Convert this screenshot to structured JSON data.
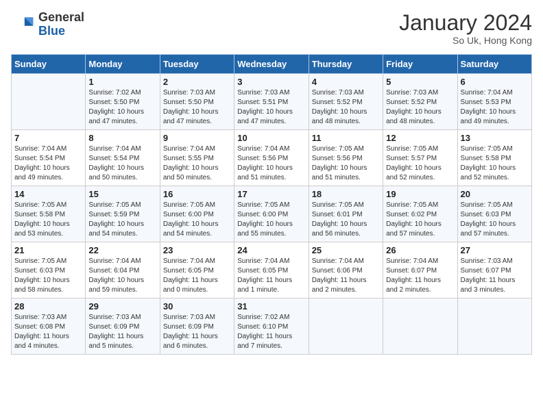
{
  "header": {
    "logo_line1": "General",
    "logo_line2": "Blue",
    "month": "January 2024",
    "location": "So Uk, Hong Kong"
  },
  "days_of_week": [
    "Sunday",
    "Monday",
    "Tuesday",
    "Wednesday",
    "Thursday",
    "Friday",
    "Saturday"
  ],
  "weeks": [
    [
      {
        "day": "",
        "info": ""
      },
      {
        "day": "1",
        "info": "Sunrise: 7:02 AM\nSunset: 5:50 PM\nDaylight: 10 hours\nand 47 minutes."
      },
      {
        "day": "2",
        "info": "Sunrise: 7:03 AM\nSunset: 5:50 PM\nDaylight: 10 hours\nand 47 minutes."
      },
      {
        "day": "3",
        "info": "Sunrise: 7:03 AM\nSunset: 5:51 PM\nDaylight: 10 hours\nand 47 minutes."
      },
      {
        "day": "4",
        "info": "Sunrise: 7:03 AM\nSunset: 5:52 PM\nDaylight: 10 hours\nand 48 minutes."
      },
      {
        "day": "5",
        "info": "Sunrise: 7:03 AM\nSunset: 5:52 PM\nDaylight: 10 hours\nand 48 minutes."
      },
      {
        "day": "6",
        "info": "Sunrise: 7:04 AM\nSunset: 5:53 PM\nDaylight: 10 hours\nand 49 minutes."
      }
    ],
    [
      {
        "day": "7",
        "info": "Sunrise: 7:04 AM\nSunset: 5:54 PM\nDaylight: 10 hours\nand 49 minutes."
      },
      {
        "day": "8",
        "info": "Sunrise: 7:04 AM\nSunset: 5:54 PM\nDaylight: 10 hours\nand 50 minutes."
      },
      {
        "day": "9",
        "info": "Sunrise: 7:04 AM\nSunset: 5:55 PM\nDaylight: 10 hours\nand 50 minutes."
      },
      {
        "day": "10",
        "info": "Sunrise: 7:04 AM\nSunset: 5:56 PM\nDaylight: 10 hours\nand 51 minutes."
      },
      {
        "day": "11",
        "info": "Sunrise: 7:05 AM\nSunset: 5:56 PM\nDaylight: 10 hours\nand 51 minutes."
      },
      {
        "day": "12",
        "info": "Sunrise: 7:05 AM\nSunset: 5:57 PM\nDaylight: 10 hours\nand 52 minutes."
      },
      {
        "day": "13",
        "info": "Sunrise: 7:05 AM\nSunset: 5:58 PM\nDaylight: 10 hours\nand 52 minutes."
      }
    ],
    [
      {
        "day": "14",
        "info": "Sunrise: 7:05 AM\nSunset: 5:58 PM\nDaylight: 10 hours\nand 53 minutes."
      },
      {
        "day": "15",
        "info": "Sunrise: 7:05 AM\nSunset: 5:59 PM\nDaylight: 10 hours\nand 54 minutes."
      },
      {
        "day": "16",
        "info": "Sunrise: 7:05 AM\nSunset: 6:00 PM\nDaylight: 10 hours\nand 54 minutes."
      },
      {
        "day": "17",
        "info": "Sunrise: 7:05 AM\nSunset: 6:00 PM\nDaylight: 10 hours\nand 55 minutes."
      },
      {
        "day": "18",
        "info": "Sunrise: 7:05 AM\nSunset: 6:01 PM\nDaylight: 10 hours\nand 56 minutes."
      },
      {
        "day": "19",
        "info": "Sunrise: 7:05 AM\nSunset: 6:02 PM\nDaylight: 10 hours\nand 57 minutes."
      },
      {
        "day": "20",
        "info": "Sunrise: 7:05 AM\nSunset: 6:03 PM\nDaylight: 10 hours\nand 57 minutes."
      }
    ],
    [
      {
        "day": "21",
        "info": "Sunrise: 7:05 AM\nSunset: 6:03 PM\nDaylight: 10 hours\nand 58 minutes."
      },
      {
        "day": "22",
        "info": "Sunrise: 7:04 AM\nSunset: 6:04 PM\nDaylight: 10 hours\nand 59 minutes."
      },
      {
        "day": "23",
        "info": "Sunrise: 7:04 AM\nSunset: 6:05 PM\nDaylight: 11 hours\nand 0 minutes."
      },
      {
        "day": "24",
        "info": "Sunrise: 7:04 AM\nSunset: 6:05 PM\nDaylight: 11 hours\nand 1 minute."
      },
      {
        "day": "25",
        "info": "Sunrise: 7:04 AM\nSunset: 6:06 PM\nDaylight: 11 hours\nand 2 minutes."
      },
      {
        "day": "26",
        "info": "Sunrise: 7:04 AM\nSunset: 6:07 PM\nDaylight: 11 hours\nand 2 minutes."
      },
      {
        "day": "27",
        "info": "Sunrise: 7:03 AM\nSunset: 6:07 PM\nDaylight: 11 hours\nand 3 minutes."
      }
    ],
    [
      {
        "day": "28",
        "info": "Sunrise: 7:03 AM\nSunset: 6:08 PM\nDaylight: 11 hours\nand 4 minutes."
      },
      {
        "day": "29",
        "info": "Sunrise: 7:03 AM\nSunset: 6:09 PM\nDaylight: 11 hours\nand 5 minutes."
      },
      {
        "day": "30",
        "info": "Sunrise: 7:03 AM\nSunset: 6:09 PM\nDaylight: 11 hours\nand 6 minutes."
      },
      {
        "day": "31",
        "info": "Sunrise: 7:02 AM\nSunset: 6:10 PM\nDaylight: 11 hours\nand 7 minutes."
      },
      {
        "day": "",
        "info": ""
      },
      {
        "day": "",
        "info": ""
      },
      {
        "day": "",
        "info": ""
      }
    ]
  ]
}
